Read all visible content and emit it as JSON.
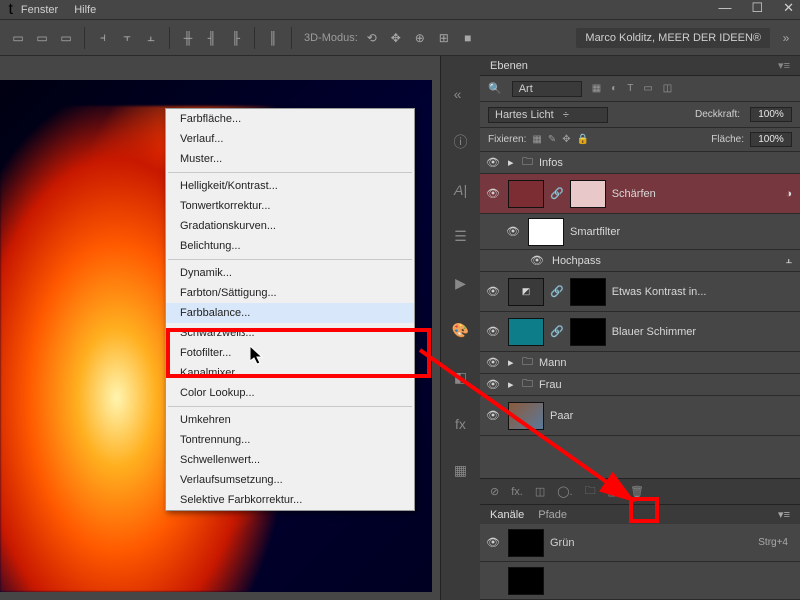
{
  "menubar": {
    "fenster": "Fenster",
    "hilfe": "Hilfe"
  },
  "toolbar": {
    "mode3d": "3D-Modus:",
    "credit": "Marco Kolditz, MEER DER IDEEN®"
  },
  "context_menu": {
    "group1": [
      "Farbfläche...",
      "Verlauf...",
      "Muster..."
    ],
    "group2": [
      "Helligkeit/Kontrast...",
      "Tonwertkorrektur...",
      "Gradationskurven...",
      "Belichtung..."
    ],
    "group3": [
      "Dynamik...",
      "Farbton/Sättigung...",
      "Farbbalance...",
      "Schwarzweiß...",
      "Fotofilter...",
      "Kanalmixer...",
      "Color Lookup..."
    ],
    "group4": [
      "Umkehren",
      "Tontrennung...",
      "Schwellenwert...",
      "Verlaufsumsetzung...",
      "Selektive Farbkorrektur..."
    ],
    "highlighted": "Farbbalance..."
  },
  "layers_panel": {
    "title": "Ebenen",
    "search_mode": "Art",
    "blend_mode": "Hartes Licht",
    "opacity_lbl": "Deckkraft:",
    "opacity_val": "100%",
    "fixieren": "Fixieren:",
    "fill_lbl": "Fläche:",
    "fill_val": "100%",
    "layers": [
      {
        "name": "Infos",
        "group": true
      },
      {
        "name": "Schärfen",
        "selected": true
      },
      {
        "name": "Smartfilter",
        "indent": true
      },
      {
        "name": "Hochpass",
        "indent": true,
        "short": true
      },
      {
        "name": "Etwas Kontrast in..."
      },
      {
        "name": "Blauer Schimmer"
      },
      {
        "name": "Mann",
        "group": true
      },
      {
        "name": "Frau",
        "group": true
      },
      {
        "name": "Paar"
      }
    ]
  },
  "channels_panel": {
    "tab1": "Kanäle",
    "tab2": "Pfade",
    "channel": "Grün",
    "shortcut": "Strg+4"
  }
}
